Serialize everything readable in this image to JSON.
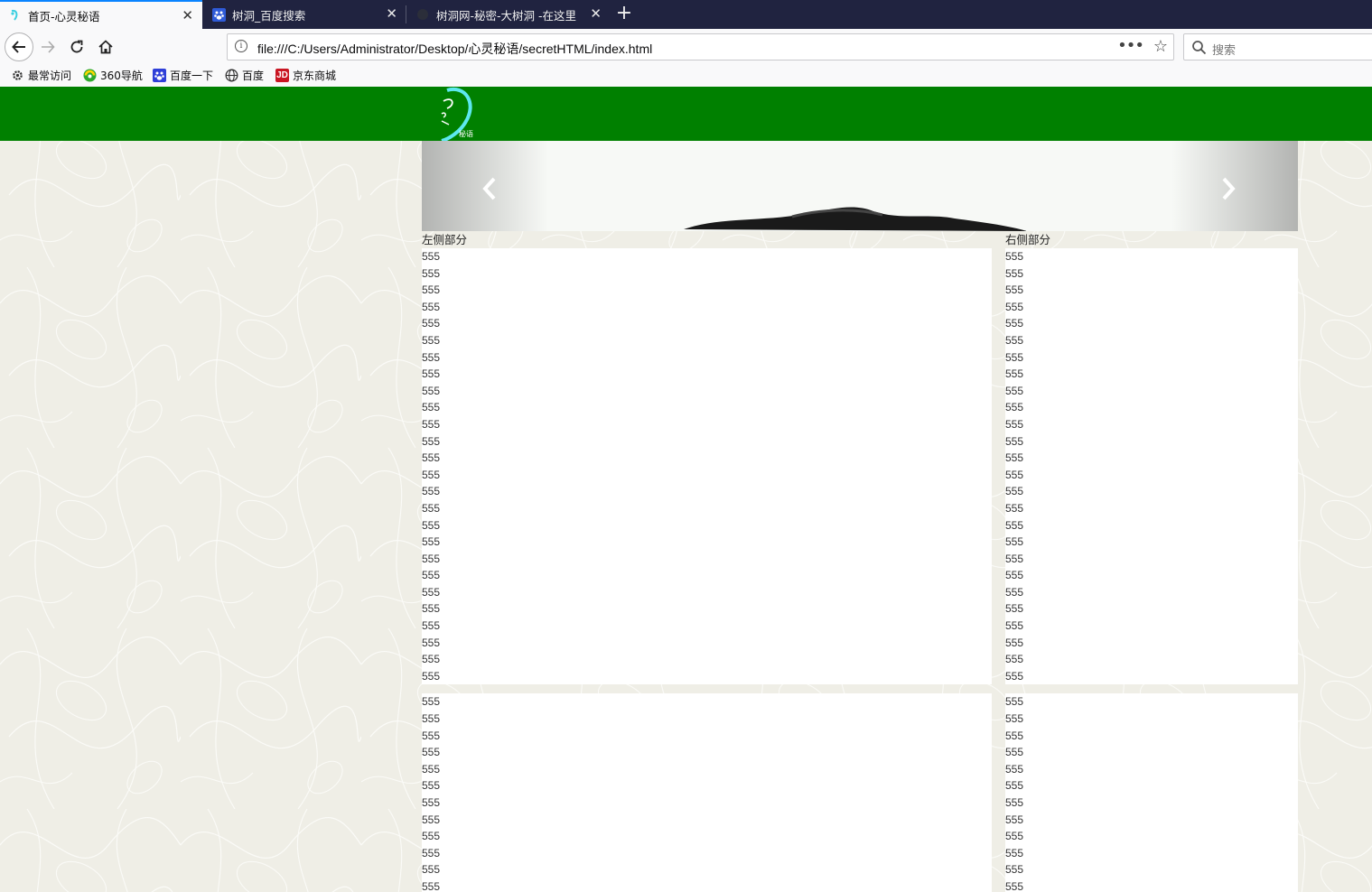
{
  "browser": {
    "tabs": [
      {
        "title": "首页-心灵秘语",
        "active": true
      },
      {
        "title": "树洞_百度搜索",
        "active": false
      },
      {
        "title": "树洞网-秘密-大树洞 -在这里，",
        "active": false
      }
    ],
    "close_glyph": "✕",
    "new_tab_glyph": "+",
    "url": "file:///C:/Users/Administrator/Desktop/心灵秘语/secretHTML/index.html",
    "url_menu_glyph": "•••",
    "star_glyph": "☆",
    "search_placeholder": "搜索",
    "bookmarks": [
      {
        "label": "最常访问",
        "icon": "gear-icon"
      },
      {
        "label": "360导航",
        "icon": "360-icon"
      },
      {
        "label": "百度一下",
        "icon": "baidu-paw-icon"
      },
      {
        "label": "百度",
        "icon": "globe-icon"
      },
      {
        "label": "京东商城",
        "icon": "jd-icon"
      }
    ],
    "jd_icon_text": "JD"
  },
  "page": {
    "header_color": "#008000",
    "carousel": {
      "prev_glyph": "‹",
      "next_glyph": "›"
    },
    "left": {
      "title": "左侧部分",
      "box1": [
        "555",
        "555",
        "555",
        "555",
        "555",
        "555",
        "555",
        "555",
        "555",
        "555",
        "555",
        "555",
        "555",
        "555",
        "555",
        "555",
        "555",
        "555",
        "555",
        "555",
        "555",
        "555",
        "555",
        "555",
        "555",
        "555"
      ],
      "box2": [
        "555",
        "555",
        "555",
        "555",
        "555",
        "555",
        "555",
        "555",
        "555",
        "555",
        "555",
        "555"
      ]
    },
    "right": {
      "title": "右侧部分",
      "box1": [
        "555",
        "555",
        "555",
        "555",
        "555",
        "555",
        "555",
        "555",
        "555",
        "555",
        "555",
        "555",
        "555",
        "555",
        "555",
        "555",
        "555",
        "555",
        "555",
        "555",
        "555",
        "555",
        "555",
        "555",
        "555",
        "555"
      ],
      "box2": [
        "555",
        "555",
        "555",
        "555",
        "555",
        "555",
        "555",
        "555",
        "555",
        "555",
        "555",
        "555"
      ]
    }
  }
}
